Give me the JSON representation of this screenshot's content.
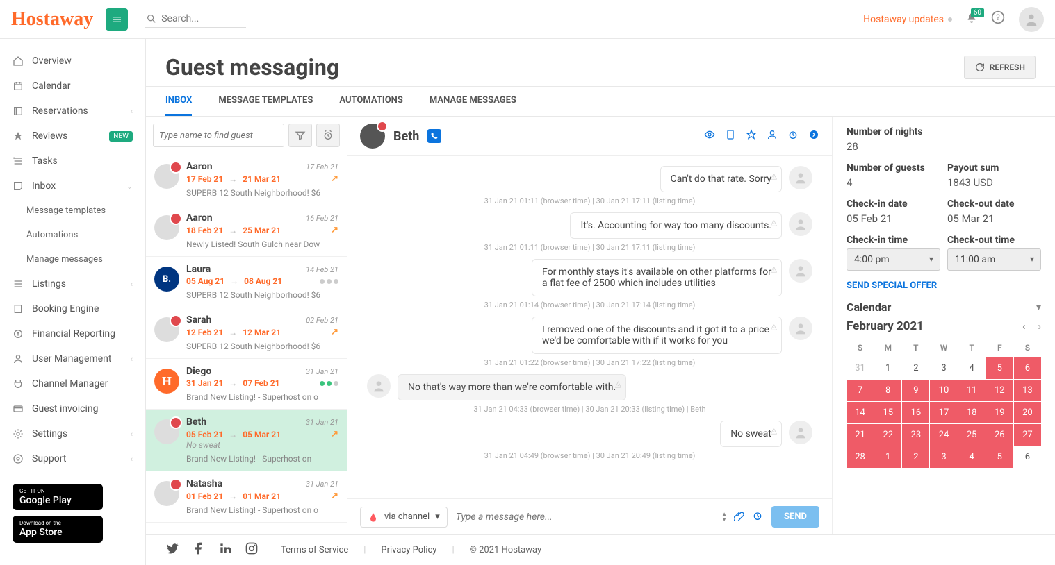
{
  "topbar": {
    "logo": "Hostaway",
    "search_placeholder": "Search...",
    "updates": "Hostaway updates",
    "notif_count": "60"
  },
  "sidebar": {
    "items": [
      {
        "label": "Overview",
        "icon": "home"
      },
      {
        "label": "Calendar",
        "icon": "calendar"
      },
      {
        "label": "Reservations",
        "icon": "reservation",
        "chevron": true
      },
      {
        "label": "Reviews",
        "icon": "star",
        "badge": "NEW"
      },
      {
        "label": "Tasks",
        "icon": "tasks"
      },
      {
        "label": "Inbox",
        "icon": "inbox",
        "chevron_down": true
      }
    ],
    "inbox_sub": [
      {
        "label": "Message templates"
      },
      {
        "label": "Automations"
      },
      {
        "label": "Manage messages"
      }
    ],
    "items2": [
      {
        "label": "Listings",
        "icon": "list",
        "chevron": true
      },
      {
        "label": "Booking Engine",
        "icon": "book"
      },
      {
        "label": "Financial Reporting",
        "icon": "finance"
      },
      {
        "label": "User Management",
        "icon": "user",
        "chevron": true
      },
      {
        "label": "Channel Manager",
        "icon": "plug"
      },
      {
        "label": "Guest invoicing",
        "icon": "card"
      },
      {
        "label": "Settings",
        "icon": "gear",
        "chevron": true
      },
      {
        "label": "Support",
        "icon": "support",
        "chevron": true
      }
    ],
    "google_play_top": "GET IT ON",
    "google_play": "Google Play",
    "app_store_top": "Download on the",
    "app_store": "App Store"
  },
  "page": {
    "title": "Guest messaging",
    "refresh": "REFRESH",
    "tabs": [
      "INBOX",
      "MESSAGE TEMPLATES",
      "AUTOMATIONS",
      "MANAGE MESSAGES"
    ]
  },
  "list": {
    "search_placeholder": "Type name to find guest",
    "items": [
      {
        "name": "Aaron",
        "top_date": "17 Feb 21",
        "from": "17 Feb 21",
        "to": "21 Mar 21",
        "listing": "SUPERB 12 South Neighborhood! $6",
        "source": "airbnb",
        "share": true
      },
      {
        "name": "Aaron",
        "top_date": "16 Feb 21",
        "from": "18 Feb 21",
        "to": "25 Mar 21",
        "listing": "Newly Listed! South Gulch near Dow",
        "source": "airbnb",
        "share": true
      },
      {
        "name": "Laura",
        "top_date": "14 Feb 21",
        "from": "05 Aug 21",
        "to": "08 Aug 21",
        "listing": "SUPERB 12 South Neighborhood! $6",
        "source": "booking",
        "dots": true
      },
      {
        "name": "Sarah",
        "top_date": "02 Feb 21",
        "from": "12 Feb 21",
        "to": "12 Mar 21",
        "listing": "SUPERB 12 South Neighborhood! $6",
        "source": "airbnb",
        "share": true
      },
      {
        "name": "Diego",
        "top_date": "31 Jan 21",
        "from": "31 Jan 21",
        "to": "07 Feb 21",
        "listing": "Brand New Listing! - Superhost on o",
        "source": "hostaway",
        "dots_green": true
      },
      {
        "name": "Beth",
        "top_date": "31 Jan 21",
        "from": "05 Feb 21",
        "to": "05 Mar 21",
        "last": "No sweat",
        "listing": "Brand New Listing! - Superhost on",
        "source": "airbnb",
        "share": true,
        "active": true
      },
      {
        "name": "Natasha",
        "top_date": "31 Jan 21",
        "from": "01 Feb 21",
        "to": "01 Mar 21",
        "listing": "Brand New Listing! - Superhost on o",
        "source": "airbnb",
        "share": true
      }
    ]
  },
  "chat": {
    "name": "Beth",
    "messages": [
      {
        "who": "them",
        "text": "Can't do that rate. Sorry",
        "time": "31 Jan 21 01:11  (browser time)  |   30 Jan 21 17:11 (listing time)"
      },
      {
        "who": "them",
        "text": "It's. Accounting for way too many discounts.",
        "time": "31 Jan 21 01:11  (browser time)  |   30 Jan 21 17:11 (listing time)"
      },
      {
        "who": "them",
        "text": "For monthly stays it's available on other platforms for a flat fee of 2500 which includes utilities",
        "time": "31 Jan 21 01:14  (browser time)  |   30 Jan 21 17:14 (listing time)"
      },
      {
        "who": "them",
        "text": "I removed one of the discounts and it got it to a price we'd be comfortable with if it works for you",
        "time": "31 Jan 21 01:22  (browser time)  |   30 Jan 21 17:22 (listing time)"
      },
      {
        "who": "me",
        "text": "No that's way more than we're comfortable with.",
        "time": "31 Jan 21 04:33  (browser time)  |   30 Jan 21 20:33 (listing time)   |  Beth"
      },
      {
        "who": "them",
        "text": "No sweat",
        "time": "31 Jan 21 04:49  (browser time)  |   30 Jan 21 20:49 (listing time)"
      }
    ],
    "via": "via channel",
    "compose_placeholder": "Type a message here...",
    "send": "SEND"
  },
  "detail": {
    "nights_label": "Number of nights",
    "nights": "28",
    "guests_label": "Number of guests",
    "guests": "4",
    "payout_label": "Payout sum",
    "payout": "1843 USD",
    "checkin_date_label": "Check-in date",
    "checkin_date": "05 Feb 21",
    "checkout_date_label": "Check-out date",
    "checkout_date": "05 Mar 21",
    "checkin_time_label": "Check-in time",
    "checkin_time": "4:00 pm",
    "checkout_time_label": "Check-out time",
    "checkout_time": "11:00 am",
    "special_offer": "SEND SPECIAL OFFER",
    "calendar_label": "Calendar",
    "month": "February 2021",
    "dow": [
      "S",
      "M",
      "T",
      "W",
      "T",
      "F",
      "S"
    ],
    "days": [
      {
        "d": "31",
        "out": true
      },
      {
        "d": "1"
      },
      {
        "d": "2"
      },
      {
        "d": "3"
      },
      {
        "d": "4"
      },
      {
        "d": "5",
        "b": true
      },
      {
        "d": "6",
        "b": true
      },
      {
        "d": "7",
        "b": true
      },
      {
        "d": "8",
        "b": true
      },
      {
        "d": "9",
        "b": true
      },
      {
        "d": "10",
        "b": true
      },
      {
        "d": "11",
        "b": true
      },
      {
        "d": "12",
        "b": true
      },
      {
        "d": "13",
        "b": true
      },
      {
        "d": "14",
        "b": true
      },
      {
        "d": "15",
        "b": true
      },
      {
        "d": "16",
        "b": true
      },
      {
        "d": "17",
        "b": true
      },
      {
        "d": "18",
        "b": true
      },
      {
        "d": "19",
        "b": true
      },
      {
        "d": "20",
        "b": true
      },
      {
        "d": "21",
        "b": true
      },
      {
        "d": "22",
        "b": true
      },
      {
        "d": "23",
        "b": true
      },
      {
        "d": "24",
        "b": true
      },
      {
        "d": "25",
        "b": true
      },
      {
        "d": "26",
        "b": true
      },
      {
        "d": "27",
        "b": true
      },
      {
        "d": "28",
        "b": true
      },
      {
        "d": "1",
        "b": true
      },
      {
        "d": "2",
        "b": true
      },
      {
        "d": "3",
        "b": true
      },
      {
        "d": "4",
        "b": true
      },
      {
        "d": "5",
        "b": true
      },
      {
        "d": "6"
      }
    ]
  },
  "footer": {
    "tos": "Terms of Service",
    "privacy": "Privacy Policy",
    "copyright": "© 2021 Hostaway"
  }
}
